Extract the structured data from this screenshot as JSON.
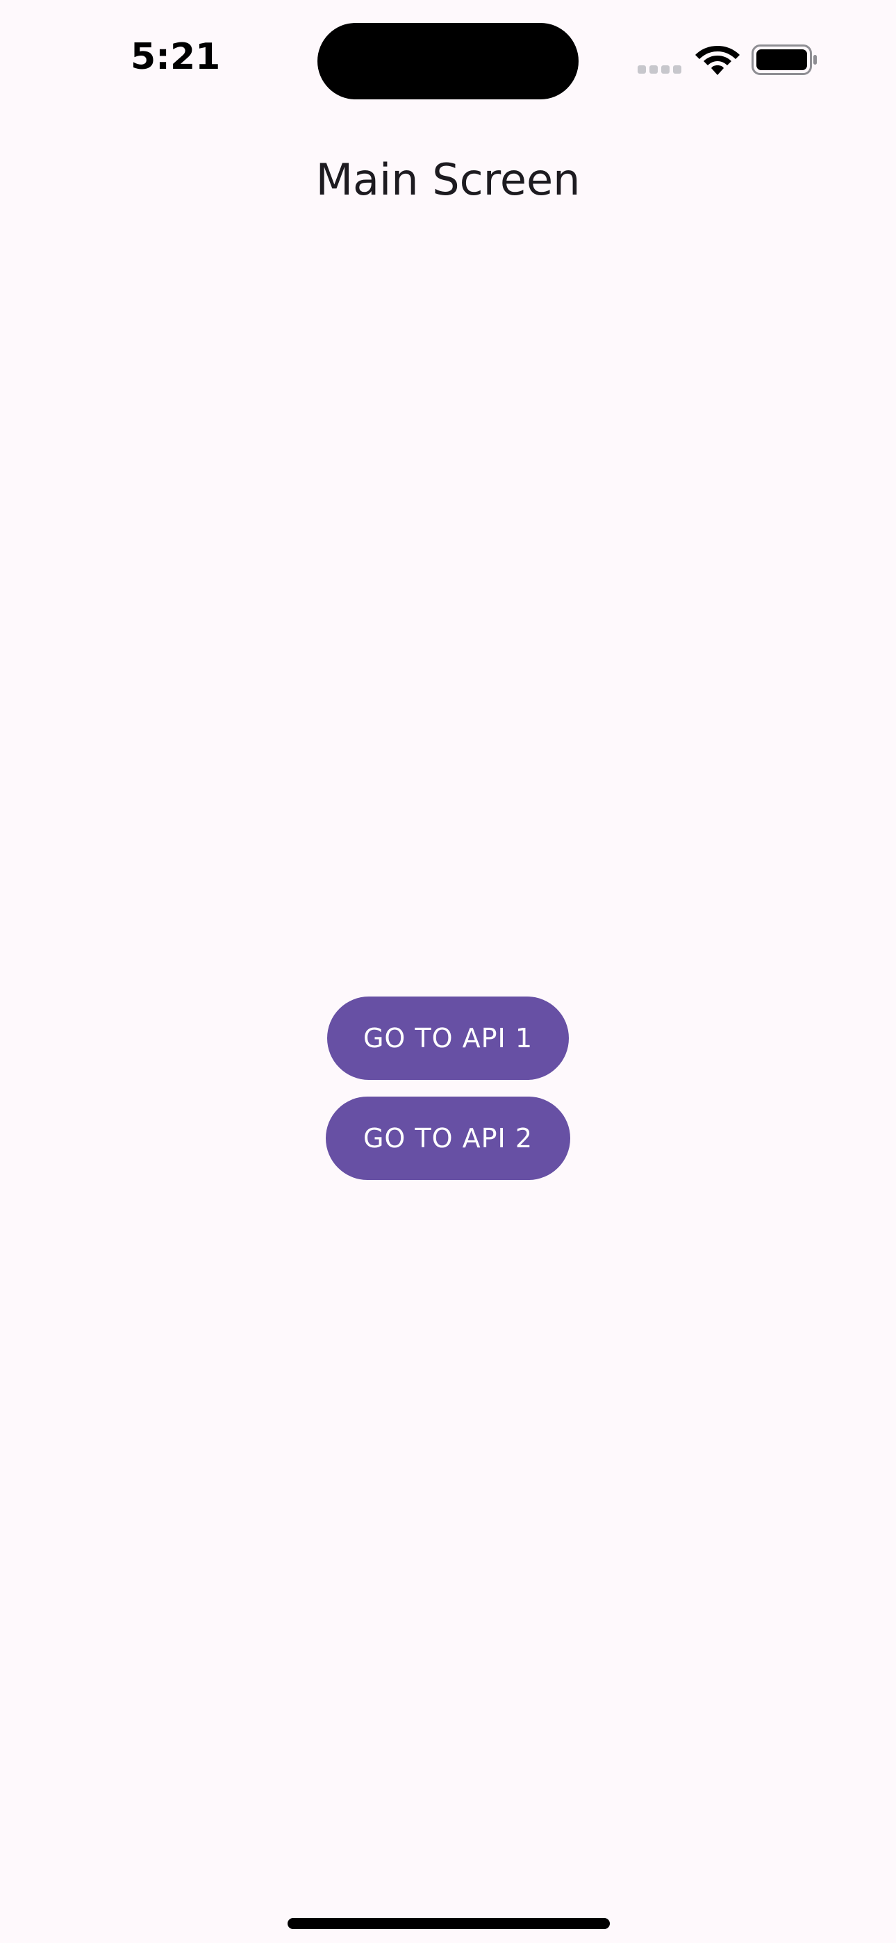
{
  "status_bar": {
    "time": "5:21",
    "icons": [
      "signal-icon",
      "wifi-icon",
      "battery-icon"
    ]
  },
  "header": {
    "title": "Main Screen"
  },
  "main": {
    "buttons": [
      {
        "label": "GO TO API 1"
      },
      {
        "label": "GO TO API 2"
      }
    ]
  },
  "colors": {
    "background": "#FEF9FC",
    "button": "#6750A4",
    "button_text": "#FFFFFF",
    "title_text": "#1D1B20"
  }
}
